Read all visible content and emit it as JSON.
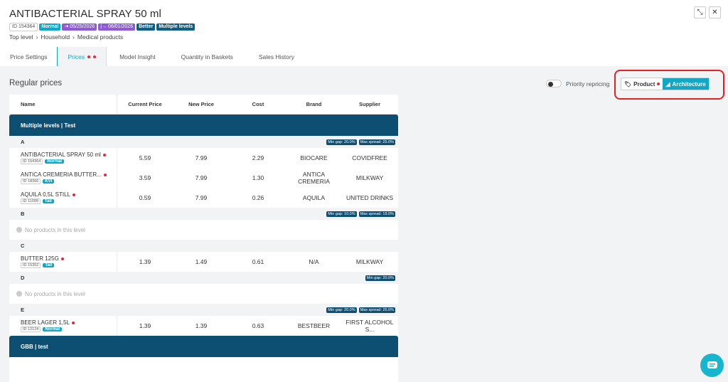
{
  "product": {
    "title": "ANTIBACTERIAL SPRAY 50 ml",
    "id": "ID 154364",
    "status": "Normal",
    "date_start": "⇥ 05/25/2026",
    "date_end": "|→ 06/01/2026",
    "tag_better": "Better",
    "tag_multi": "Multiple levels"
  },
  "breadcrumb": [
    "Top level",
    "Household",
    "Medical products"
  ],
  "tabs": [
    "Price Settings",
    "Prices",
    "Model Insight",
    "Quantity in Baskets",
    "Sales History"
  ],
  "section_title": "Regular prices",
  "priority_label": "Priority repricing",
  "segment": {
    "product": "Product",
    "architecture": "Architecture"
  },
  "columns": [
    "Name",
    "Current Price",
    "New Price",
    "Cost",
    "Brand",
    "Supplier"
  ],
  "groups": [
    {
      "title": "Multiple levels | Test",
      "levels": [
        {
          "label": "A",
          "tags": [
            "Min gap: 20.0%",
            "Max spread: 25.0%"
          ],
          "products": [
            {
              "name": "ANTIBACTERIAL SPRAY 50 ml",
              "id": "ID 154364",
              "tag": "Normal",
              "current": "5.59",
              "new": "7.99",
              "cost": "2.29",
              "brand": "BIOCARE",
              "supplier": "COVIDFREE"
            },
            {
              "name": "ANTICA CREMERIA BUTTER...",
              "id": "ID 18366",
              "tag": "KVI",
              "current": "3.59",
              "new": "7.99",
              "cost": "1.30",
              "brand": "ANTICA CREMERIA",
              "supplier": "MILKWAY"
            },
            {
              "name": "AQUILA 0,5L STILL",
              "id": "ID 11099",
              "tag": "Tail",
              "current": "0.59",
              "new": "7.99",
              "cost": "0.26",
              "brand": "AQUILA",
              "supplier": "UNITED DRINKS"
            }
          ]
        },
        {
          "label": "B",
          "tags": [
            "Min gap: 10.0%",
            "Max spread: 19.0%"
          ],
          "empty": "No products in this level"
        },
        {
          "label": "C",
          "tags": [],
          "products": [
            {
              "name": "BUTTER 125G",
              "id": "ID 15352",
              "tag": "Tail",
              "current": "1.39",
              "new": "1.49",
              "cost": "0.61",
              "brand": "N/A",
              "supplier": "MILKWAY"
            }
          ]
        },
        {
          "label": "D",
          "tags": [
            "Min gap: 20.0%"
          ],
          "empty": "No products in this level"
        },
        {
          "label": "E",
          "tags": [
            "Min gap: 20.0%",
            "Max spread: 25.0%"
          ],
          "products": [
            {
              "name": "BEER LAGER 1,5L",
              "id": "ID 12124",
              "tag": "Normal",
              "current": "1.39",
              "new": "1.39",
              "cost": "0.63",
              "brand": "BESTBEER",
              "supplier": "FIRST ALCOHOL S..."
            }
          ]
        }
      ]
    },
    {
      "title": "GBB | test",
      "levels": []
    }
  ],
  "colors": {
    "accent": "#12a7c5",
    "dark": "#0d4f73",
    "highlight": "#e32222"
  }
}
